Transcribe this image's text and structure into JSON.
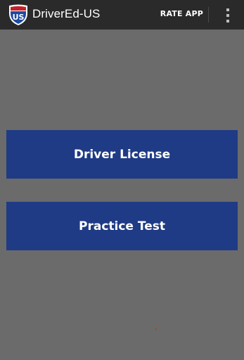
{
  "app_bar": {
    "title": "DriverEd-US",
    "logo_icon": "interstate-shield-logo",
    "logo_text": "US",
    "rate_label": "RATE APP",
    "overflow_icon": "overflow-menu-icon"
  },
  "main": {
    "buttons": [
      {
        "label": "Driver License"
      },
      {
        "label": "Practice Test"
      }
    ]
  },
  "colors": {
    "app_bar_bg": "#2a2a2a",
    "screen_bg": "#6b6b6b",
    "button_bg": "#1f3b86",
    "shield_blue": "#1e4aa0",
    "shield_red": "#c8202a"
  }
}
